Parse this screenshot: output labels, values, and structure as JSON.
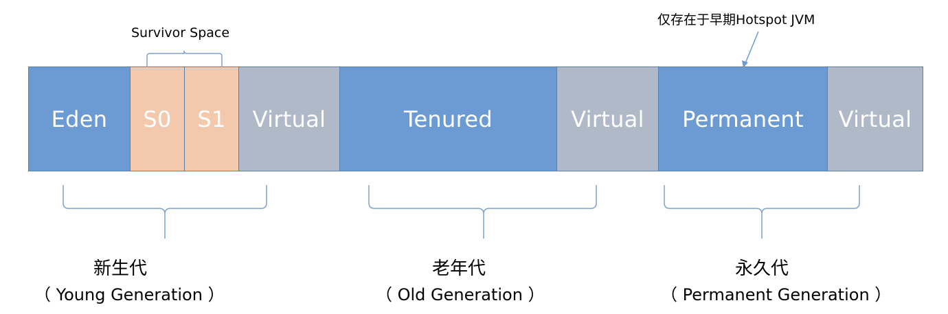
{
  "cells": [
    {
      "label": "Eden",
      "kind": "young"
    },
    {
      "label": "S0",
      "kind": "survivor"
    },
    {
      "label": "S1",
      "kind": "survivor"
    },
    {
      "label": "Virtual",
      "kind": "virtual"
    },
    {
      "label": "Tenured",
      "kind": "old"
    },
    {
      "label": "Virtual",
      "kind": "virtual"
    },
    {
      "label": "Permanent",
      "kind": "perm"
    },
    {
      "label": "Virtual",
      "kind": "virtual"
    }
  ],
  "annotations": {
    "survivor_space": "Survivor Space",
    "hotspot_note": "仅存在于早期Hotspot JVM"
  },
  "groups": [
    {
      "cn": "新生代",
      "en": "（ Young Generation ）"
    },
    {
      "cn": "老年代",
      "en": "（ Old Generation ）"
    },
    {
      "cn": "永久代",
      "en": "（ Permanent Generation ）"
    }
  ],
  "colors": {
    "blue": "#6b9bd2",
    "peach": "#f2c9ad",
    "gray": "#b0b9c8",
    "border": "#5a7fae",
    "brace": "#7fa2cc"
  }
}
